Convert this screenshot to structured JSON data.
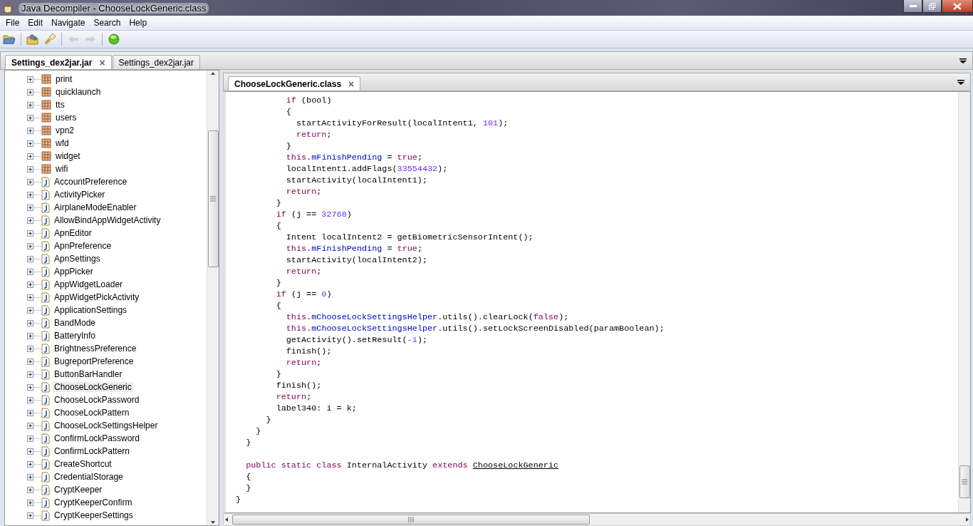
{
  "window": {
    "title": "Java Decompiler - ChooseLockGeneric.class"
  },
  "menu": [
    "File",
    "Edit",
    "Navigate",
    "Search",
    "Help"
  ],
  "toolbar": [
    {
      "kind": "open",
      "disabled": false
    },
    {
      "kind": "sep"
    },
    {
      "kind": "open-type",
      "disabled": false
    },
    {
      "kind": "search",
      "disabled": false
    },
    {
      "kind": "sep"
    },
    {
      "kind": "back",
      "disabled": true
    },
    {
      "kind": "forward",
      "disabled": true
    },
    {
      "kind": "sep"
    },
    {
      "kind": "go",
      "disabled": false
    }
  ],
  "file_tabs": [
    {
      "label": "Settings_dex2jar.jar",
      "selected": true,
      "close": "×"
    },
    {
      "label": "Settings_dex2jar.jar",
      "selected": false
    }
  ],
  "tree": [
    {
      "kind": "package",
      "label": "print",
      "selected": false
    },
    {
      "kind": "package",
      "label": "quicklaunch",
      "selected": false
    },
    {
      "kind": "package",
      "label": "tts",
      "selected": false
    },
    {
      "kind": "package",
      "label": "users",
      "selected": false
    },
    {
      "kind": "package",
      "label": "vpn2",
      "selected": false
    },
    {
      "kind": "package",
      "label": "wfd",
      "selected": false
    },
    {
      "kind": "package",
      "label": "widget",
      "selected": false
    },
    {
      "kind": "package",
      "label": "wifi",
      "selected": false
    },
    {
      "kind": "class",
      "label": "AccountPreference",
      "selected": false
    },
    {
      "kind": "class",
      "label": "ActivityPicker",
      "selected": false
    },
    {
      "kind": "class",
      "label": "AirplaneModeEnabler",
      "selected": false
    },
    {
      "kind": "class",
      "label": "AllowBindAppWidgetActivity",
      "selected": false
    },
    {
      "kind": "class",
      "label": "ApnEditor",
      "selected": false
    },
    {
      "kind": "class",
      "label": "ApnPreference",
      "selected": false
    },
    {
      "kind": "class",
      "label": "ApnSettings",
      "selected": false
    },
    {
      "kind": "class",
      "label": "AppPicker",
      "selected": false
    },
    {
      "kind": "class",
      "label": "AppWidgetLoader",
      "selected": false
    },
    {
      "kind": "class",
      "label": "AppWidgetPickActivity",
      "selected": false
    },
    {
      "kind": "class",
      "label": "ApplicationSettings",
      "selected": false
    },
    {
      "kind": "class",
      "label": "BandMode",
      "selected": false
    },
    {
      "kind": "class",
      "label": "BatteryInfo",
      "selected": false
    },
    {
      "kind": "class",
      "label": "BrightnessPreference",
      "selected": false
    },
    {
      "kind": "class",
      "label": "BugreportPreference",
      "selected": false
    },
    {
      "kind": "class",
      "label": "ButtonBarHandler",
      "selected": false
    },
    {
      "kind": "class",
      "label": "ChooseLockGeneric",
      "selected": true
    },
    {
      "kind": "class",
      "label": "ChooseLockPassword",
      "selected": false
    },
    {
      "kind": "class",
      "label": "ChooseLockPattern",
      "selected": false
    },
    {
      "kind": "class",
      "label": "ChooseLockSettingsHelper",
      "selected": false
    },
    {
      "kind": "class",
      "label": "ConfirmLockPassword",
      "selected": false
    },
    {
      "kind": "class",
      "label": "ConfirmLockPattern",
      "selected": false
    },
    {
      "kind": "class",
      "label": "CreateShortcut",
      "selected": false
    },
    {
      "kind": "class",
      "label": "CredentialStorage",
      "selected": false
    },
    {
      "kind": "class",
      "label": "CryptKeeper",
      "selected": false
    },
    {
      "kind": "class",
      "label": "CryptKeeperConfirm",
      "selected": false
    },
    {
      "kind": "class",
      "label": "CryptKeeperSettings",
      "selected": false
    }
  ],
  "editor_tabs": [
    {
      "label": "ChooseLockGeneric.class",
      "selected": true,
      "close": "×"
    }
  ],
  "code": [
    {
      "tokens": [
        {
          "kind": "keyword",
          "t": "          if"
        },
        {
          "kind": "plain",
          "t": " (bool)"
        }
      ]
    },
    {
      "tokens": [
        {
          "kind": "plain",
          "t": "          {"
        }
      ]
    },
    {
      "tokens": [
        {
          "kind": "plain",
          "t": "            startActivityForResult(localIntent1, "
        },
        {
          "kind": "number",
          "t": "101"
        },
        {
          "kind": "plain",
          "t": ");"
        }
      ]
    },
    {
      "tokens": [
        {
          "kind": "keyword",
          "t": "            return"
        },
        {
          "kind": "plain",
          "t": ";"
        }
      ]
    },
    {
      "tokens": [
        {
          "kind": "plain",
          "t": "          }"
        }
      ]
    },
    {
      "tokens": [
        {
          "kind": "keyword",
          "t": "          this"
        },
        {
          "kind": "plain",
          "t": "."
        },
        {
          "kind": "field",
          "t": "mFinishPending"
        },
        {
          "kind": "plain",
          "t": " = "
        },
        {
          "kind": "keyword",
          "t": "true"
        },
        {
          "kind": "plain",
          "t": ";"
        }
      ]
    },
    {
      "tokens": [
        {
          "kind": "plain",
          "t": "          localIntent1.addFlags("
        },
        {
          "kind": "number",
          "t": "33554432"
        },
        {
          "kind": "plain",
          "t": ");"
        }
      ]
    },
    {
      "tokens": [
        {
          "kind": "plain",
          "t": "          startActivity(localIntent1);"
        }
      ]
    },
    {
      "tokens": [
        {
          "kind": "keyword",
          "t": "          return"
        },
        {
          "kind": "plain",
          "t": ";"
        }
      ]
    },
    {
      "tokens": [
        {
          "kind": "plain",
          "t": "        }"
        }
      ]
    },
    {
      "tokens": [
        {
          "kind": "keyword",
          "t": "        if"
        },
        {
          "kind": "plain",
          "t": " (j == "
        },
        {
          "kind": "number",
          "t": "32768"
        },
        {
          "kind": "plain",
          "t": ")"
        }
      ]
    },
    {
      "tokens": [
        {
          "kind": "plain",
          "t": "        {"
        }
      ]
    },
    {
      "tokens": [
        {
          "kind": "plain",
          "t": "          Intent localIntent2 = getBiometricSensorIntent();"
        }
      ]
    },
    {
      "tokens": [
        {
          "kind": "keyword",
          "t": "          this"
        },
        {
          "kind": "plain",
          "t": "."
        },
        {
          "kind": "field",
          "t": "mFinishPending"
        },
        {
          "kind": "plain",
          "t": " = "
        },
        {
          "kind": "keyword",
          "t": "true"
        },
        {
          "kind": "plain",
          "t": ";"
        }
      ]
    },
    {
      "tokens": [
        {
          "kind": "plain",
          "t": "          startActivity(localIntent2);"
        }
      ]
    },
    {
      "tokens": [
        {
          "kind": "keyword",
          "t": "          return"
        },
        {
          "kind": "plain",
          "t": ";"
        }
      ]
    },
    {
      "tokens": [
        {
          "kind": "plain",
          "t": "        }"
        }
      ]
    },
    {
      "tokens": [
        {
          "kind": "keyword",
          "t": "        if"
        },
        {
          "kind": "plain",
          "t": " (j == "
        },
        {
          "kind": "number",
          "t": "0"
        },
        {
          "kind": "plain",
          "t": ")"
        }
      ]
    },
    {
      "tokens": [
        {
          "kind": "plain",
          "t": "        {"
        }
      ]
    },
    {
      "tokens": [
        {
          "kind": "keyword",
          "t": "          this"
        },
        {
          "kind": "plain",
          "t": "."
        },
        {
          "kind": "field",
          "t": "mChooseLockSettingsHelper"
        },
        {
          "kind": "plain",
          "t": ".utils().clearLock("
        },
        {
          "kind": "keyword",
          "t": "false"
        },
        {
          "kind": "plain",
          "t": ");"
        }
      ]
    },
    {
      "tokens": [
        {
          "kind": "keyword",
          "t": "          this"
        },
        {
          "kind": "plain",
          "t": "."
        },
        {
          "kind": "field",
          "t": "mChooseLockSettingsHelper"
        },
        {
          "kind": "plain",
          "t": ".utils().setLockScreenDisabled(paramBoolean);"
        }
      ]
    },
    {
      "tokens": [
        {
          "kind": "plain",
          "t": "          getActivity().setResult("
        },
        {
          "kind": "number",
          "t": "-1"
        },
        {
          "kind": "plain",
          "t": ");"
        }
      ]
    },
    {
      "tokens": [
        {
          "kind": "plain",
          "t": "          finish();"
        }
      ]
    },
    {
      "tokens": [
        {
          "kind": "keyword",
          "t": "          return"
        },
        {
          "kind": "plain",
          "t": ";"
        }
      ]
    },
    {
      "tokens": [
        {
          "kind": "plain",
          "t": "        }"
        }
      ]
    },
    {
      "tokens": [
        {
          "kind": "plain",
          "t": "        finish();"
        }
      ]
    },
    {
      "tokens": [
        {
          "kind": "keyword",
          "t": "        return"
        },
        {
          "kind": "plain",
          "t": ";"
        }
      ]
    },
    {
      "tokens": [
        {
          "kind": "plain",
          "t": "        label340: i = k;"
        }
      ]
    },
    {
      "tokens": [
        {
          "kind": "plain",
          "t": "      }"
        }
      ]
    },
    {
      "tokens": [
        {
          "kind": "plain",
          "t": "    }"
        }
      ]
    },
    {
      "tokens": [
        {
          "kind": "plain",
          "t": "  }"
        }
      ]
    },
    {
      "blank_before": true,
      "tokens": [
        {
          "kind": "keyword",
          "t": "  public static class"
        },
        {
          "kind": "plain",
          "t": " InternalActivity "
        },
        {
          "kind": "keyword",
          "t": "extends "
        },
        {
          "kind": "link",
          "t": "ChooseLockGeneric"
        }
      ]
    },
    {
      "tokens": [
        {
          "kind": "plain",
          "t": "  {"
        }
      ]
    },
    {
      "tokens": [
        {
          "kind": "plain",
          "t": "  }"
        }
      ]
    },
    {
      "tokens": [
        {
          "kind": "plain",
          "t": "}"
        }
      ]
    }
  ]
}
